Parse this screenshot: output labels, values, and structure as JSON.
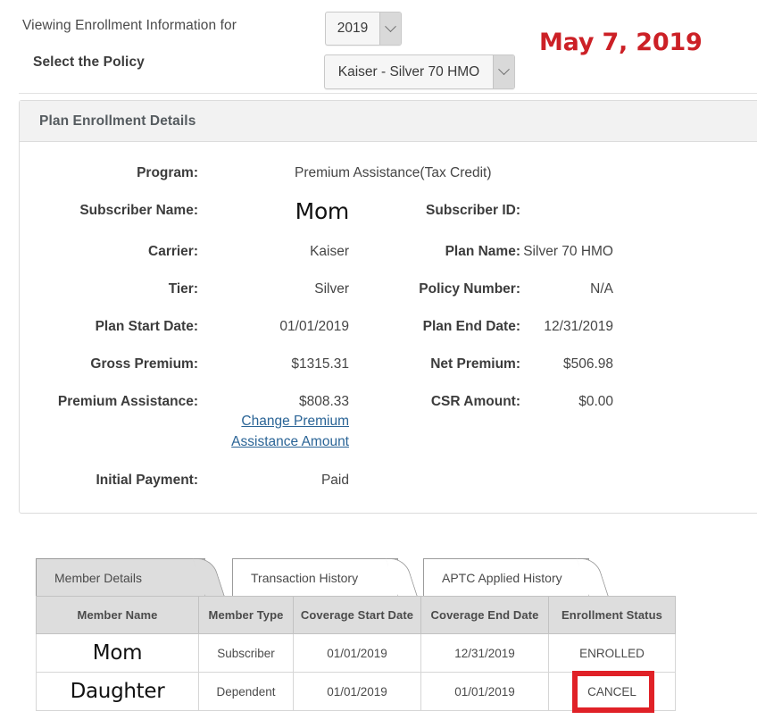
{
  "header": {
    "viewing_label": "Viewing Enrollment Information for",
    "policy_label": "Select the Policy",
    "year_select": {
      "value": "2019"
    },
    "policy_select": {
      "value": "Kaiser - Silver 70 HMO"
    },
    "date_stamp": "May 7, 2019"
  },
  "panel": {
    "title": "Plan Enrollment Details",
    "program": {
      "label": "Program:",
      "value": "Premium Assistance(Tax Credit)"
    },
    "rows": [
      {
        "left_label": "Subscriber Name:",
        "left_value": "Mom",
        "right_label": "Subscriber ID:",
        "right_value": ""
      },
      {
        "left_label": "Carrier:",
        "left_value": "Kaiser",
        "right_label": "Plan Name:",
        "right_value": "Silver 70 HMO"
      },
      {
        "left_label": "Tier:",
        "left_value": "Silver",
        "right_label": "Policy Number:",
        "right_value": "N/A"
      },
      {
        "left_label": "Plan Start Date:",
        "left_value": "01/01/2019",
        "right_label": "Plan End Date:",
        "right_value": "12/31/2019"
      },
      {
        "left_label": "Gross Premium:",
        "left_value": "$1315.31",
        "right_label": "Net Premium:",
        "right_value": "$506.98"
      },
      {
        "left_label": "Premium Assistance:",
        "left_value": "$808.33",
        "right_label": "CSR Amount:",
        "right_value": "$0.00"
      },
      {
        "left_label": "Initial Payment:",
        "left_value": "Paid",
        "right_label": "",
        "right_value": ""
      }
    ],
    "change_premium_link": "Change Premium Assistance Amount"
  },
  "tabs": [
    {
      "label": "Member Details",
      "active": true
    },
    {
      "label": "Transaction History",
      "active": false
    },
    {
      "label": "APTC Applied History",
      "active": false
    }
  ],
  "table": {
    "columns": [
      "Member Name",
      "Member Type",
      "Coverage Start Date",
      "Coverage End Date",
      "Enrollment Status"
    ],
    "rows": [
      [
        "Mom",
        "Subscriber",
        "01/01/2019",
        "12/31/2019",
        "ENROLLED"
      ],
      [
        "Daughter",
        "Dependent",
        "01/01/2019",
        "01/01/2019",
        "CANCEL"
      ]
    ]
  },
  "annotation": {
    "highlight_color": "#E02127",
    "date_color": "#CC2026"
  }
}
